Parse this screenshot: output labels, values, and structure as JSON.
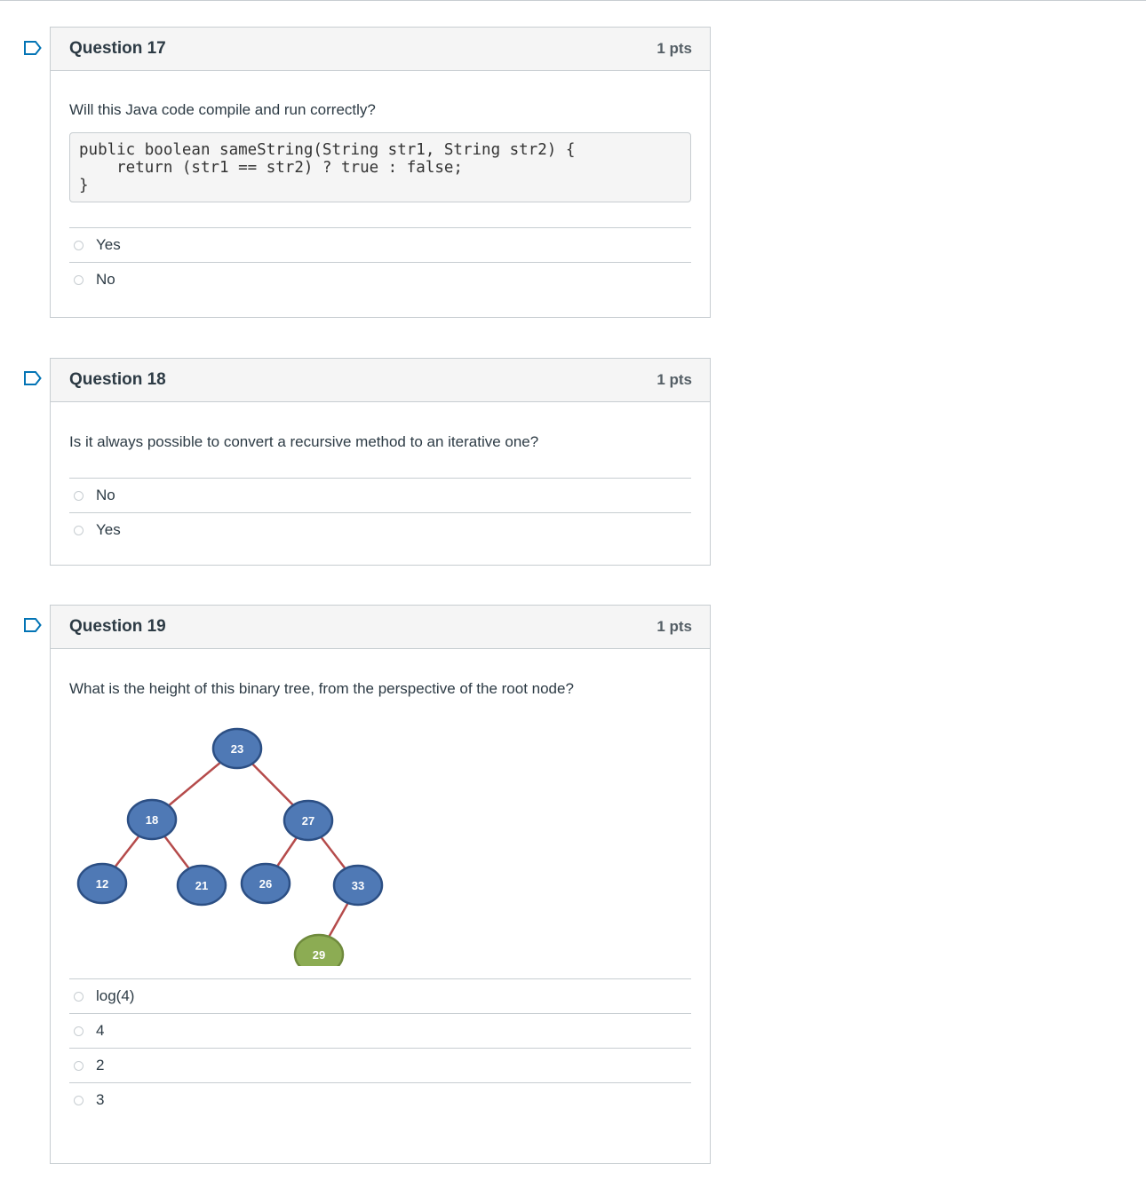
{
  "colors": {
    "flag": "#0374b5",
    "node_blue": "#4f79b5",
    "node_green": "#8cac53",
    "edge": "#b54b4b"
  },
  "questions": [
    {
      "title": "Question 17",
      "points": "1 pts",
      "prompt": "Will this Java code compile and run correctly?",
      "code": "public boolean sameString(String str1, String str2) {\n    return (str1 == str2) ? true : false;\n}",
      "answers": [
        "Yes",
        "No"
      ]
    },
    {
      "title": "Question 18",
      "points": "1 pts",
      "prompt": "Is it always possible to convert a recursive method to an iterative one?",
      "answers": [
        "No",
        "Yes"
      ]
    },
    {
      "title": "Question 19",
      "points": "1 pts",
      "prompt": "What is the height of this binary tree, from the perspective of the root node?",
      "tree": {
        "nodes": [
          {
            "id": "n23",
            "label": "23",
            "color": "blue"
          },
          {
            "id": "n18",
            "label": "18",
            "color": "blue"
          },
          {
            "id": "n27",
            "label": "27",
            "color": "blue"
          },
          {
            "id": "n12",
            "label": "12",
            "color": "blue"
          },
          {
            "id": "n21",
            "label": "21",
            "color": "blue"
          },
          {
            "id": "n26",
            "label": "26",
            "color": "blue"
          },
          {
            "id": "n33",
            "label": "33",
            "color": "blue"
          },
          {
            "id": "n29",
            "label": "29",
            "color": "green"
          }
        ],
        "edges": [
          [
            "n23",
            "n18"
          ],
          [
            "n23",
            "n27"
          ],
          [
            "n18",
            "n12"
          ],
          [
            "n18",
            "n21"
          ],
          [
            "n27",
            "n26"
          ],
          [
            "n27",
            "n33"
          ],
          [
            "n33",
            "n29"
          ]
        ]
      },
      "answers": [
        "log(4)",
        "4",
        "2",
        "3"
      ]
    }
  ]
}
